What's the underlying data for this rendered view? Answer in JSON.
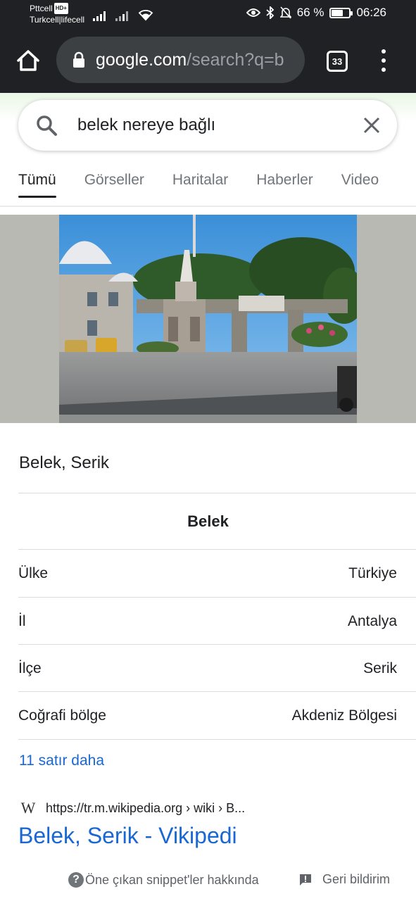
{
  "status_bar": {
    "carrier_1": "Pttcell",
    "carrier_1_badge": "HD+",
    "carrier_2": "Turkcell|lifecell",
    "battery": "66 %",
    "battery_level": 0.66,
    "time": "06:26"
  },
  "browser": {
    "url_host": "google.com",
    "url_path": "/search?q=b",
    "tab_count": "33"
  },
  "search": {
    "query": "belek nereye bağlı",
    "tabs": [
      "Tümü",
      "Görseller",
      "Haritalar",
      "Haberler",
      "Video"
    ],
    "active_tab": 0
  },
  "infobox": {
    "title": "Belek, Serik",
    "caption": "Belek",
    "rows": [
      {
        "label": "Ülke",
        "value": "Türkiye"
      },
      {
        "label": "İl",
        "value": "Antalya"
      },
      {
        "label": "İlçe",
        "value": "Serik"
      },
      {
        "label": "Coğrafi bölge",
        "value": "Akdeniz Bölgesi"
      }
    ],
    "more_link": "11 satır daha"
  },
  "result": {
    "source_icon": "W",
    "url": "https://tr.m.wikipedia.org › wiki › B...",
    "title": "Belek, Serik - Vikipedi"
  },
  "footer": {
    "snippet_about": "Öne çıkan snippet'ler hakkında",
    "feedback": "Geri bildirim"
  },
  "colors": {
    "accent_link": "#1967d2",
    "toolbar_bg": "#202124",
    "url_bar_bg": "#3c4043"
  }
}
